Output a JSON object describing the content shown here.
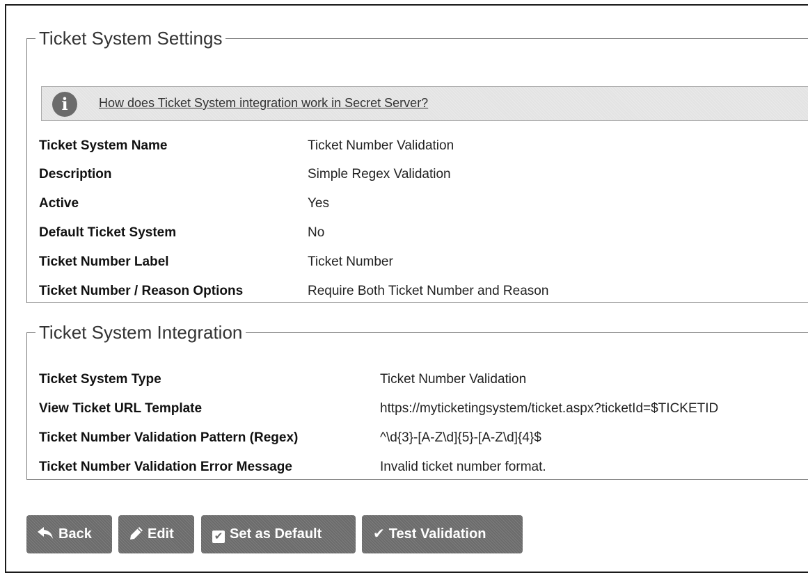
{
  "settings": {
    "legend": "Ticket System Settings",
    "info_link": "How does Ticket System integration work in Secret Server?",
    "rows": [
      {
        "label": "Ticket System Name",
        "value": "Ticket Number Validation"
      },
      {
        "label": "Description",
        "value": "Simple Regex Validation"
      },
      {
        "label": "Active",
        "value": "Yes"
      },
      {
        "label": "Default Ticket System",
        "value": "No"
      },
      {
        "label": "Ticket Number Label",
        "value": "Ticket Number"
      },
      {
        "label": "Ticket Number / Reason Options",
        "value": "Require Both Ticket Number and Reason"
      }
    ]
  },
  "integration": {
    "legend": "Ticket System Integration",
    "rows": [
      {
        "label": "Ticket System Type",
        "value": "Ticket Number Validation"
      },
      {
        "label": "View Ticket URL Template",
        "value": "https://myticketingsystem/ticket.aspx?ticketId=$TICKETID"
      },
      {
        "label": "Ticket Number Validation Pattern (Regex)",
        "value": "^\\d{3}-[A-Z\\d]{5}-[A-Z\\d]{4}$"
      },
      {
        "label": "Ticket Number Validation Error Message",
        "value": "Invalid ticket number format."
      }
    ]
  },
  "buttons": {
    "back": "Back",
    "edit": "Edit",
    "set_default": "Set as Default",
    "test_validation": "Test Validation"
  },
  "icons": {
    "info": "info-icon",
    "back": "reply-arrow-icon",
    "edit": "pencil-icon",
    "set_default": "checkbox-icon",
    "test_validation": "checkmark-icon"
  },
  "colors": {
    "button_bg": "#6b6b6b",
    "info_bar_bg": "#e3e3e3"
  }
}
